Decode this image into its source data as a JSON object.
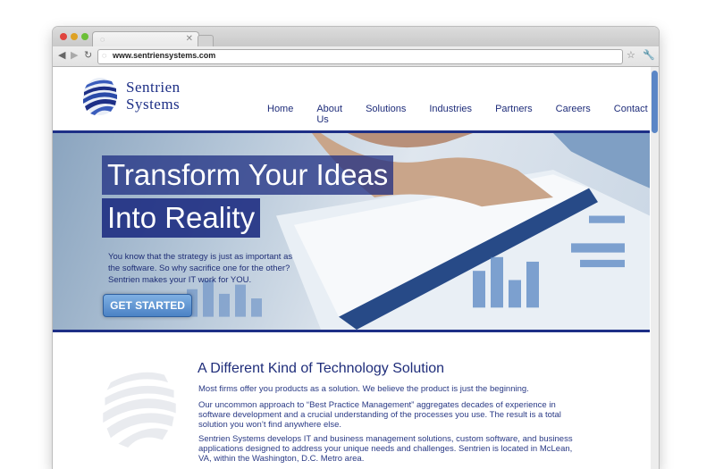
{
  "browser": {
    "tab_title": "",
    "url": "www.sentriensystems.com"
  },
  "site": {
    "logo": {
      "line1": "Sentrien",
      "line2": "Systems"
    },
    "nav": [
      "Home",
      "About Us",
      "Solutions",
      "Industries",
      "Partners",
      "Careers",
      "Contact"
    ]
  },
  "hero": {
    "headline_line1": "Transform Your Ideas",
    "headline_line2": "Into Reality",
    "copy": "You know that the strategy is just as important as the software. So why sacrifice one for the other? Sentrien makes your IT work for YOU.",
    "cta_label": "GET STARTED"
  },
  "content": {
    "title": "A Different Kind of Technology Solution",
    "paragraphs": [
      "Most firms offer you products as a solution. We believe the product is just the beginning.",
      "Our uncommon approach to “Best Practice Management” aggregates decades of experience in software development and a crucial understanding of the processes you use. The result is a total solution you won’t find anywhere else.",
      "Sentrien Systems develops IT and business management solutions, custom software, and business applications designed to address your unique needs and challenges. Sentrien is located in McLean, VA, within the Washington, D.C. Metro area."
    ]
  },
  "colors": {
    "brand_blue": "#1d2f86",
    "cta_blue": "#4b82c5",
    "scroll_thumb": "#5a86c6"
  }
}
